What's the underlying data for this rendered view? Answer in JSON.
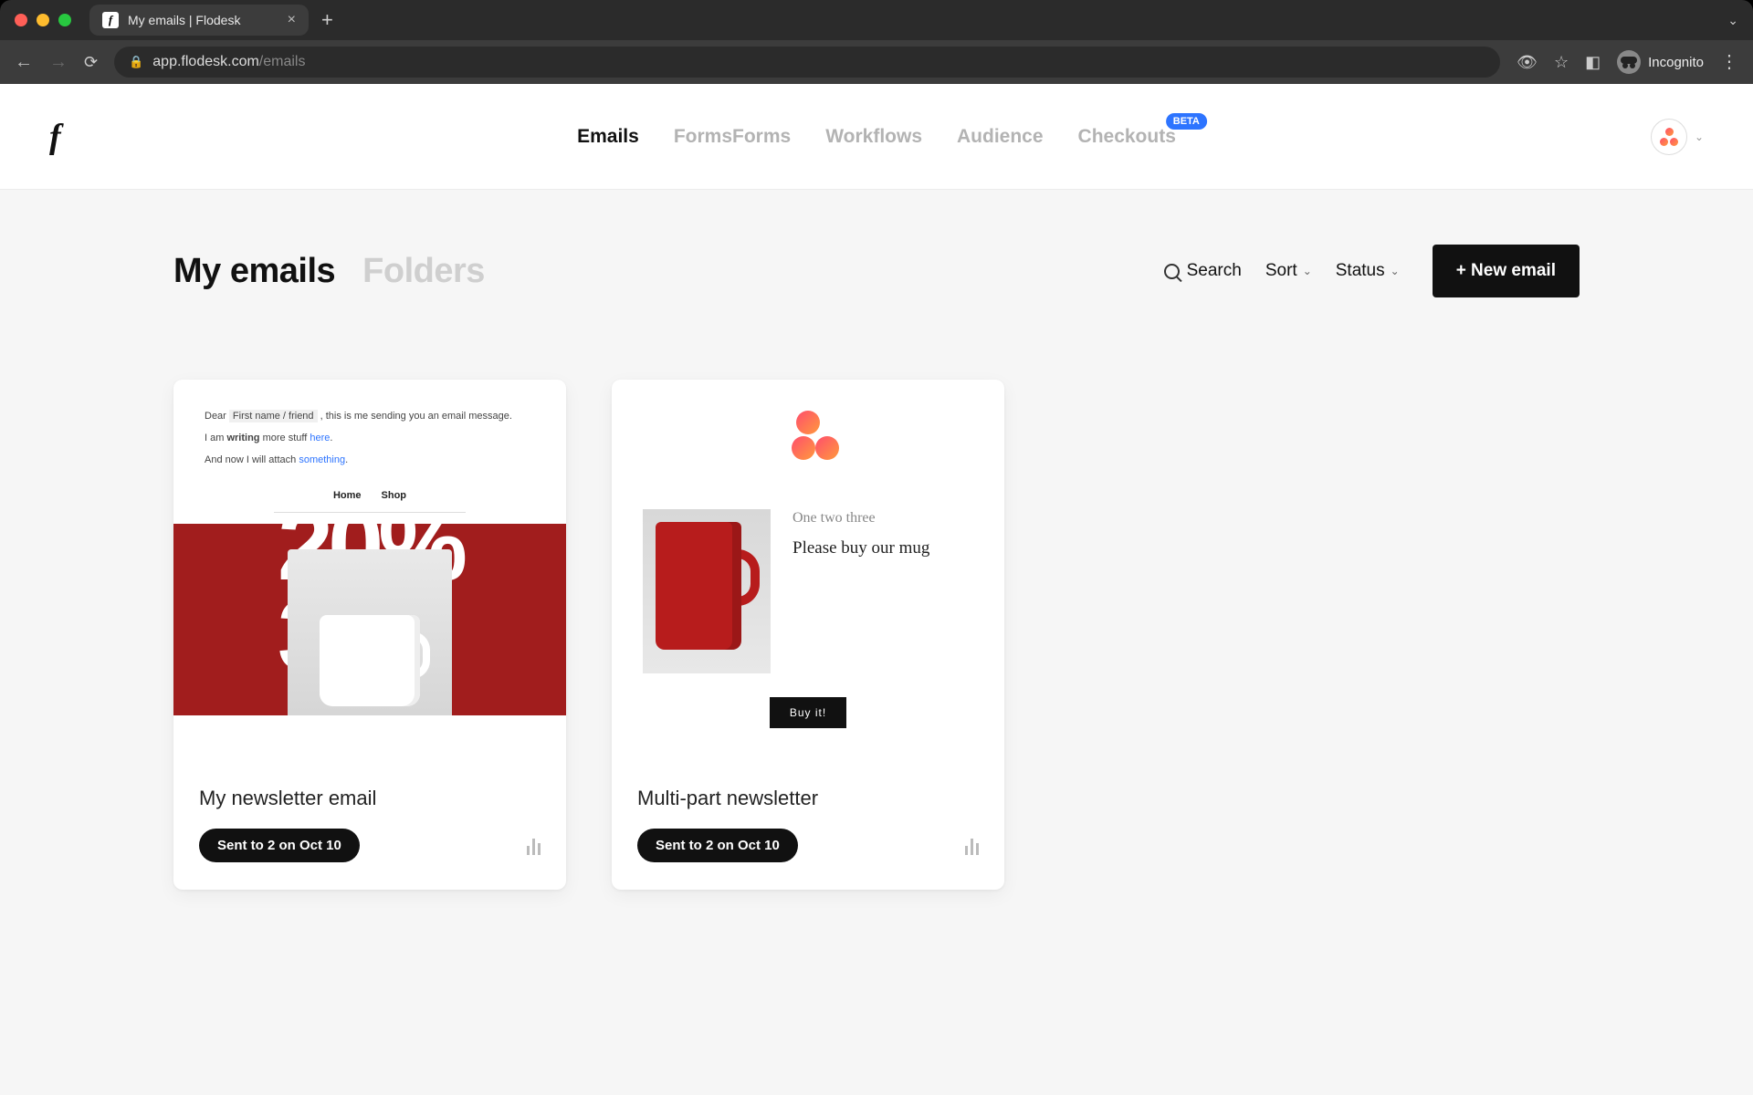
{
  "browser": {
    "tab_title": "My emails | Flodesk",
    "url_host": "app.flodesk.com",
    "url_path": "/emails",
    "incognito_label": "Incognito"
  },
  "nav": {
    "items": [
      "Emails",
      "Forms",
      "Workflows",
      "Audience",
      "Checkouts"
    ],
    "active_index": 0,
    "beta_label": "BETA"
  },
  "page": {
    "tabs": [
      "My emails",
      "Folders"
    ],
    "active_tab_index": 0,
    "search_label": "Search",
    "sort_label": "Sort",
    "status_label": "Status",
    "new_email_label": "+ New email"
  },
  "cards": [
    {
      "title": "My newsletter email",
      "status": "Sent to 2 on Oct 10",
      "preview": {
        "greeting_prefix": "Dear ",
        "merge_tag": "First name / friend",
        "greeting_suffix": " , this is me sending you an email message.",
        "line2_a": "I am ",
        "line2_b": "writing",
        "line2_c": " more stuff ",
        "line2_link": "here",
        "line2_d": ".",
        "line3_a": "And now I will attach ",
        "line3_link": "something",
        "line3_b": ".",
        "nav": [
          "Home",
          "Shop"
        ]
      }
    },
    {
      "title": "Multi-part newsletter",
      "status": "Sent to 2 on Oct 10",
      "preview": {
        "script": "One two three",
        "headline": "Please buy our mug",
        "cta": "Buy it!"
      }
    }
  ]
}
